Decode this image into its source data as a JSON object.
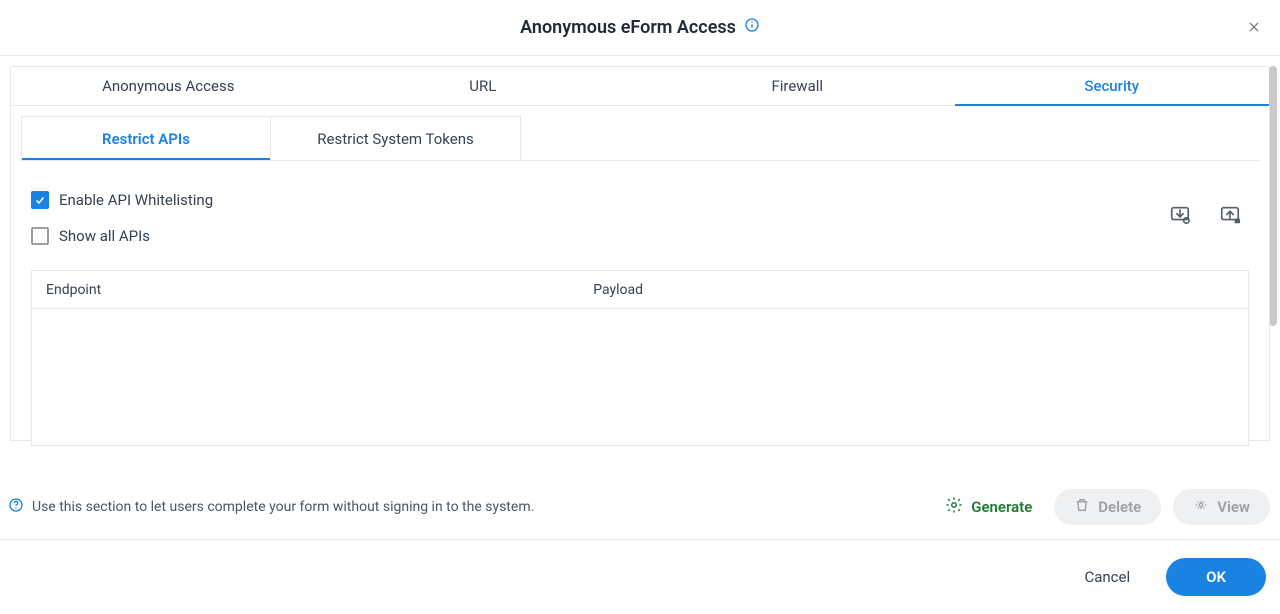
{
  "header": {
    "title": "Anonymous eForm Access"
  },
  "tabs": {
    "anonymous_access": "Anonymous Access",
    "url": "URL",
    "firewall": "Firewall",
    "security": "Security"
  },
  "subtabs": {
    "restrict_apis": "Restrict APIs",
    "restrict_tokens": "Restrict System Tokens"
  },
  "options": {
    "enable_whitelisting": "Enable API Whitelisting",
    "show_all": "Show all APIs"
  },
  "table": {
    "endpoint": "Endpoint",
    "payload": "Payload"
  },
  "footer": {
    "hint": "Use this section to let users complete your form without signing in to the system.",
    "generate": "Generate",
    "delete": "Delete",
    "view": "View",
    "cancel": "Cancel",
    "ok": "OK"
  }
}
